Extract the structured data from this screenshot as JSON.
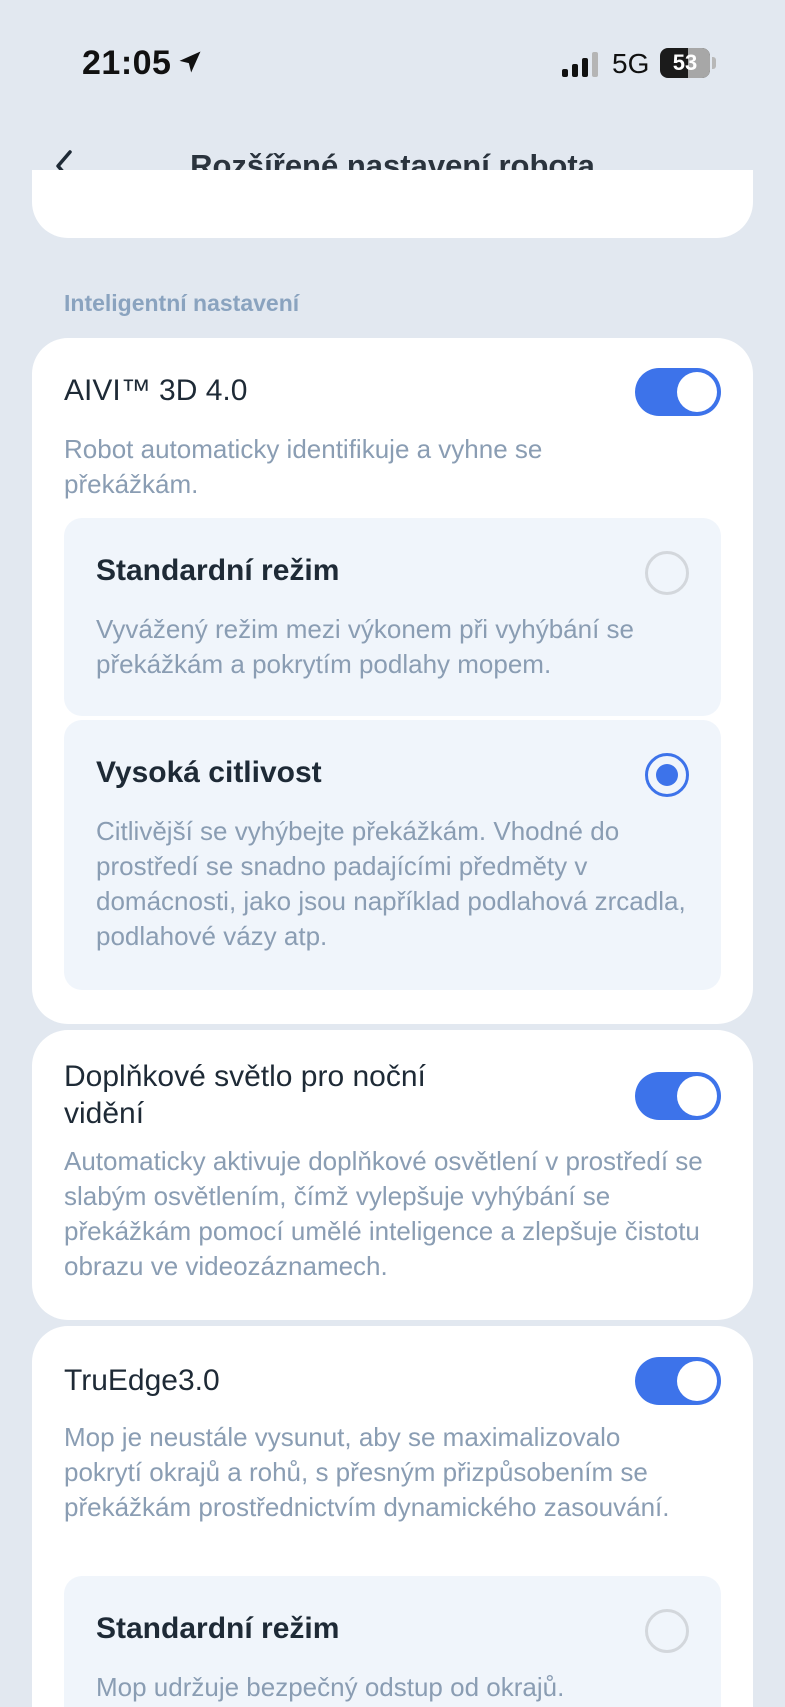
{
  "status_bar": {
    "time": "21:05",
    "network": "5G",
    "battery": "53"
  },
  "header": {
    "title": "Rozšířené nastavení robota"
  },
  "section": {
    "header": "Inteligentní nastavení"
  },
  "aivi": {
    "title": "AIVI™ 3D 4.0",
    "description": "Robot automaticky identifikuje a vyhne se překážkám.",
    "enabled": true,
    "options": [
      {
        "title": "Standardní režim",
        "description": "Vyvážený režim mezi výkonem při vyhýbání se překážkám a pokrytím podlahy mopem.",
        "selected": false
      },
      {
        "title": "Vysoká citlivost",
        "description": "Citlivější se vyhýbejte překážkám. Vhodné do prostředí se snadno padajícími předměty v domácnosti, jako jsou například podlahová zrcadla, podlahové vázy atp.",
        "selected": true
      }
    ]
  },
  "night_light": {
    "title": "Doplňkové světlo pro noční vidění",
    "description": "Automaticky aktivuje doplňkové osvětlení v prostředí se slabým osvětlením, čímž vylepšuje vyhýbání se překážkám pomocí umělé inteligence a zlepšuje čistotu obrazu ve videozáznamech.",
    "enabled": true
  },
  "truedge": {
    "title": "TruEdge3.0",
    "description": "Mop je neustále vysunut, aby se maximalizovalo pokrytí okrajů a rohů, s přesným přizpůsobením se překážkám prostřednictvím dynamického zasouvání.",
    "enabled": true,
    "options": [
      {
        "title": "Standardní režim",
        "description": "Mop udržuje bezpečný odstup od okrajů.",
        "selected": false
      }
    ]
  },
  "colors": {
    "accent": "#3d73ea",
    "background": "#e2e8f0",
    "card": "#ffffff",
    "option_background": "#f0f5fb",
    "secondary_text": "#8a9db3"
  },
  "icons": {
    "location": "location-arrow-icon",
    "signal": "cellular-signal-icon",
    "battery": "battery-icon",
    "back": "chevron-left-icon"
  }
}
